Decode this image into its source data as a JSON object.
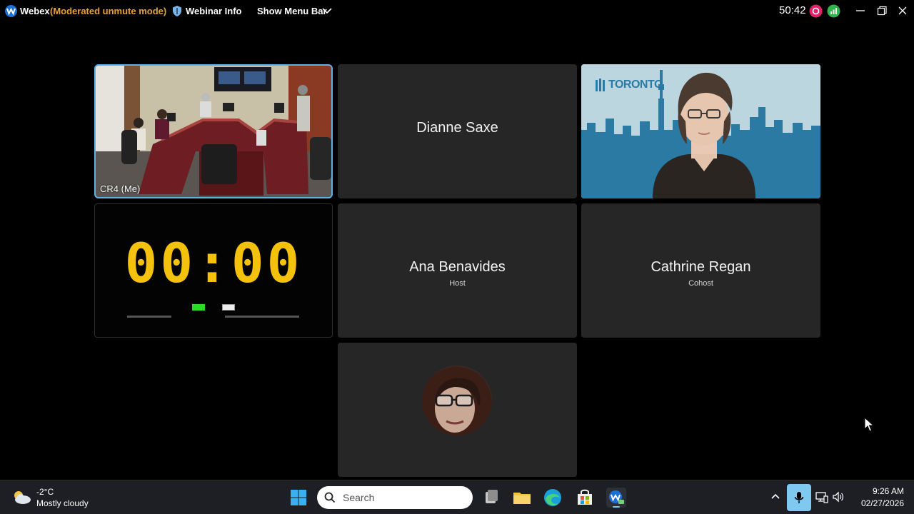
{
  "titlebar": {
    "app_name": "Webex",
    "mode": "(Moderated unmute mode)",
    "webinar_info": "Webinar Info",
    "show_menu_bar": "Show Menu Bar",
    "elapsed": "50:42"
  },
  "tiles": {
    "room": {
      "label": "CR4 (Me)"
    },
    "dianne": {
      "name": "Dianne Saxe"
    },
    "toronto": {
      "logo_text": "TORONTO"
    },
    "timer": {
      "clock": "00:00"
    },
    "ana": {
      "name": "Ana Benavides",
      "role": "Host"
    },
    "cathrine": {
      "name": "Cathrine Regan",
      "role": "Cohost"
    }
  },
  "taskbar": {
    "weather_temp": "-2°C",
    "weather_desc": "Mostly cloudy",
    "search_placeholder": "Search",
    "time": "9:26 AM",
    "date": "02/27/2026"
  },
  "colors": {
    "mode_orange": "#e8a23a",
    "active_tile_border": "#5ab2e8",
    "clock_yellow": "#f4c20d",
    "tile_bg": "#262626",
    "mic_active": "#7fc8f0"
  }
}
